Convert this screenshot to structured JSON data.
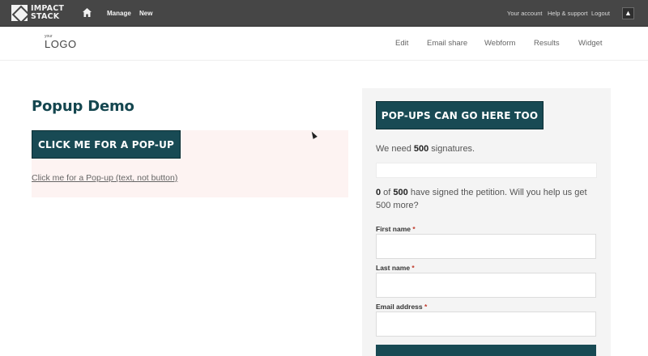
{
  "adminbar": {
    "brand": "IMPACT\nSTACK",
    "nav": {
      "manage": "Manage",
      "new": "New"
    },
    "account_links": [
      "Your account",
      "Help & support",
      "Logout"
    ],
    "up_icon": "arrow-up"
  },
  "header": {
    "logo_small": "your",
    "logo_main": "LOGO",
    "tabs": [
      "Edit",
      "Email share",
      "Webform",
      "Results",
      "Widget"
    ]
  },
  "main": {
    "title": "Popup Demo",
    "popup_button": "CLICK ME FOR A POP-UP",
    "popup_link": "Click me for a Pop-up (text, not button)"
  },
  "panel": {
    "button": "POP-UPS CAN GO HERE TOO",
    "need_prefix": "We need ",
    "goal": "500",
    "need_suffix": " signatures.",
    "signed_count": "0",
    "signed_of": " of ",
    "signed_goal": "500",
    "signed_suffix": " have signed the petition. Will you help us get 500 more?",
    "progress_fraction": 0,
    "fields": [
      {
        "label": "First name",
        "required": "*"
      },
      {
        "label": "Last name",
        "required": "*"
      },
      {
        "label": "Email address",
        "required": "*"
      }
    ]
  },
  "colors": {
    "primary": "#184a54",
    "adminbar": "#464646",
    "panel_bg": "#f4f4f4",
    "pink_bg": "#fdf3f2"
  }
}
